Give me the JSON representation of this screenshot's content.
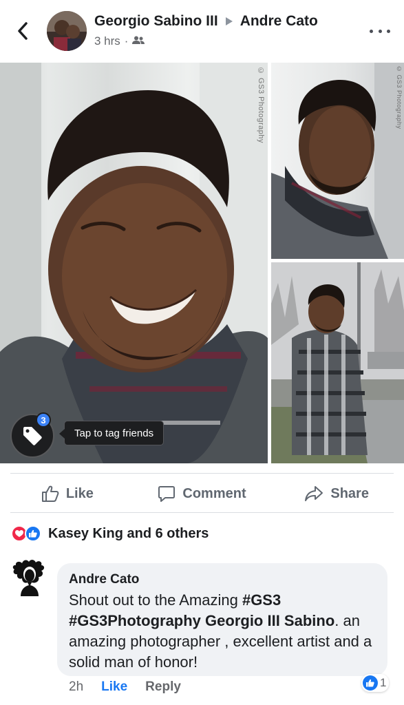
{
  "header": {
    "author": "Georgio Sabino III",
    "recipient": "Andre Cato",
    "time": "3 hrs",
    "separator": "·",
    "audience_icon": "friends-icon",
    "back_icon": "chevron-left-icon",
    "more_icon": "more-horizontal-icon"
  },
  "photos": {
    "watermark": "© GS3 Photography",
    "tag_count": "3",
    "tag_tooltip": "Tap to tag friends"
  },
  "actions": {
    "like": "Like",
    "comment": "Comment",
    "share": "Share"
  },
  "reactions": {
    "summary": "Kasey King and 6 others"
  },
  "comment": {
    "author": "Andre Cato",
    "text_part1": "Shout out to the Amazing ",
    "hashtag1": "#GS3",
    "hashtag2": "#GS3Photography",
    "mention": " Georgio III Sabino",
    "text_part2": ". an amazing photographer , excellent artist and a solid man of honor!",
    "time": "2h",
    "like_label": "Like",
    "reply_label": "Reply",
    "reaction_count": "1"
  },
  "colors": {
    "accent": "#1877f2",
    "heart": "#f0284a",
    "bubble": "#f0f2f5"
  }
}
